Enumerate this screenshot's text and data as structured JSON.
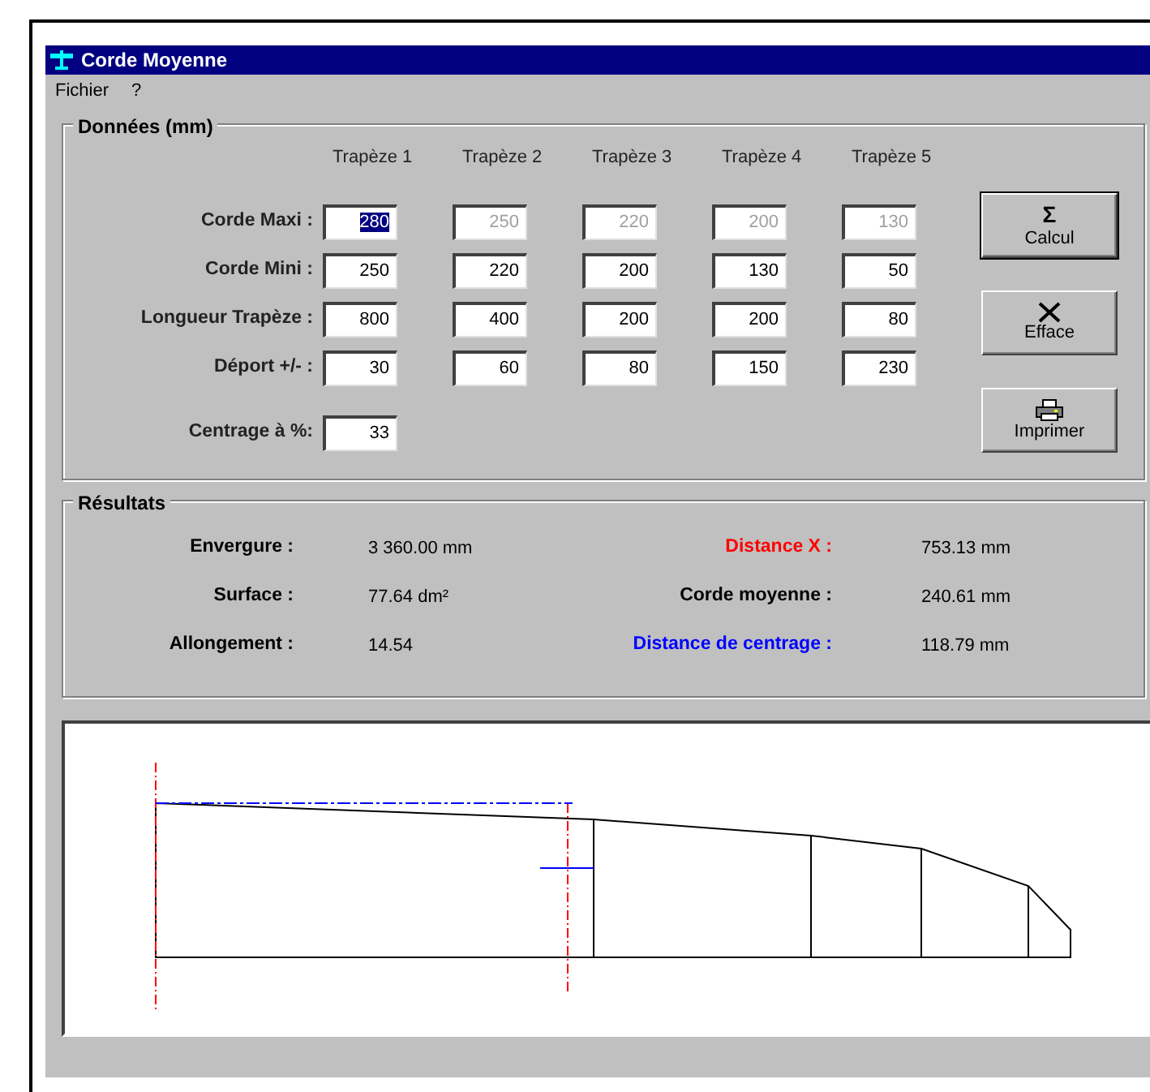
{
  "window": {
    "title": "Corde Moyenne"
  },
  "menu": [
    {
      "label": "Fichier"
    },
    {
      "label": "?"
    }
  ],
  "donnees": {
    "title": "Données (mm)",
    "columns": [
      "Trapèze 1",
      "Trapèze 2",
      "Trapèze 3",
      "Trapèze 4",
      "Trapèze 5"
    ],
    "rows": [
      {
        "label": "Corde Maxi :",
        "cells": [
          {
            "value": "280",
            "selected": true,
            "disabled": false
          },
          {
            "value": "250",
            "selected": false,
            "disabled": true
          },
          {
            "value": "220",
            "selected": false,
            "disabled": true
          },
          {
            "value": "200",
            "selected": false,
            "disabled": true
          },
          {
            "value": "130",
            "selected": false,
            "disabled": true
          }
        ]
      },
      {
        "label": "Corde Mini :",
        "cells": [
          {
            "value": "250",
            "selected": false,
            "disabled": false
          },
          {
            "value": "220",
            "selected": false,
            "disabled": false
          },
          {
            "value": "200",
            "selected": false,
            "disabled": false
          },
          {
            "value": "130",
            "selected": false,
            "disabled": false
          },
          {
            "value": "50",
            "selected": false,
            "disabled": false
          }
        ]
      },
      {
        "label": "Longueur Trapèze :",
        "cells": [
          {
            "value": "800",
            "selected": false,
            "disabled": false
          },
          {
            "value": "400",
            "selected": false,
            "disabled": false
          },
          {
            "value": "200",
            "selected": false,
            "disabled": false
          },
          {
            "value": "200",
            "selected": false,
            "disabled": false
          },
          {
            "value": "80",
            "selected": false,
            "disabled": false
          }
        ]
      },
      {
        "label": "Déport +/- :",
        "cells": [
          {
            "value": "30",
            "selected": false,
            "disabled": false
          },
          {
            "value": "60",
            "selected": false,
            "disabled": false
          },
          {
            "value": "80",
            "selected": false,
            "disabled": false
          },
          {
            "value": "150",
            "selected": false,
            "disabled": false
          },
          {
            "value": "230",
            "selected": false,
            "disabled": false
          }
        ]
      }
    ],
    "centrage": {
      "label": "Centrage à %:",
      "value": "33"
    },
    "buttons": [
      {
        "kind": "sigma",
        "icon": "Σ",
        "label": "Calcul",
        "default": true
      },
      {
        "kind": "cross",
        "label": "Efface",
        "default": false
      },
      {
        "kind": "printer",
        "label": "Imprimer",
        "default": false
      }
    ]
  },
  "resultats": {
    "title": "Résultats",
    "rows": [
      {
        "left": {
          "label": "Envergure :",
          "value": "3 360.00 mm"
        },
        "right": {
          "label": "Distance X :",
          "value": "753.13 mm",
          "color": "#ff0000"
        }
      },
      {
        "left": {
          "label": "Surface :",
          "value": "77.64 dm²"
        },
        "right": {
          "label": "Corde moyenne :",
          "value": "240.61 mm",
          "color": "#000000"
        }
      },
      {
        "left": {
          "label": "Allongement :",
          "value": "14.54"
        },
        "right": {
          "label": "Distance de centrage :",
          "value": "118.79 mm",
          "color": "#0000ff"
        }
      }
    ]
  }
}
